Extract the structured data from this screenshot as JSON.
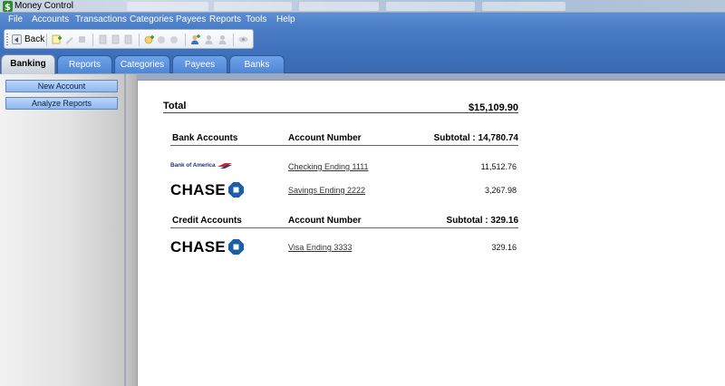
{
  "window": {
    "title": "Money Control"
  },
  "menu": [
    "File",
    "Accounts",
    "Transactions",
    "Categories",
    "Payees",
    "Reports",
    "Tools",
    "Help"
  ],
  "toolbar": {
    "back_label": "Back"
  },
  "tabs": [
    {
      "label": "Banking",
      "active": true
    },
    {
      "label": "Reports",
      "active": false
    },
    {
      "label": "Categories",
      "active": false
    },
    {
      "label": "Payees",
      "active": false
    },
    {
      "label": "Banks",
      "active": false
    }
  ],
  "sidebar": {
    "buttons": [
      "New Account",
      "Analyze Reports"
    ]
  },
  "summary": {
    "total_label": "Total",
    "total_value": "$15,109.90"
  },
  "bank_section": {
    "title": "Bank Accounts",
    "col_label": "Account Number",
    "subtotal": "Subtotal : 14,780.74",
    "accounts": [
      {
        "bank": "Bank of America",
        "logo_text": "Bank of America",
        "name": "Checking Ending 1111",
        "amount": "11,512.76"
      },
      {
        "bank": "Chase",
        "logo_text": "CHASE",
        "name": "Savings Ending 2222",
        "amount": "3,267.98"
      }
    ]
  },
  "credit_section": {
    "title": "Credit Accounts",
    "col_label": "Account Number",
    "subtotal": "Subtotal : 329.16",
    "accounts": [
      {
        "bank": "Chase",
        "logo_text": "CHASE",
        "name": "Visa Ending 3333",
        "amount": "329.16"
      }
    ]
  },
  "colors": {
    "menu_blue": "#4a7cc6",
    "chase_blue": "#1a5fa8",
    "boa_red": "#d2232a",
    "boa_navy": "#1e3c7f"
  },
  "icons": [
    "dollar-app-icon",
    "back-arrow-icon",
    "add-icon",
    "edit-icon",
    "delete-icon",
    "add-user-icon",
    "user-icon",
    "eye-icon"
  ]
}
